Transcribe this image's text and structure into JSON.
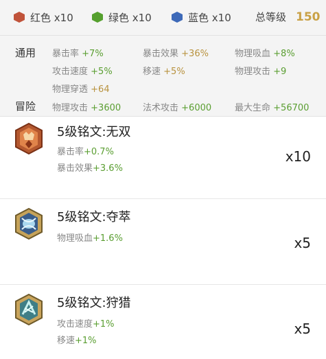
{
  "summary": {
    "gems": [
      {
        "label": "红色 x10",
        "color": "#c0533a"
      },
      {
        "label": "绿色 x10",
        "color": "#55a02e"
      },
      {
        "label": "蓝色 x10",
        "color": "#3d69b8"
      }
    ],
    "total_label": "总等级",
    "total_value": "150",
    "total_color": "#c9a146"
  },
  "stats": {
    "common_label": "通用",
    "adventure_label": "冒险",
    "common": [
      {
        "name": "暴击率",
        "value": "+7%"
      },
      {
        "name": "暴击效果",
        "value": "+36%"
      },
      {
        "name": "物理吸血",
        "value": "+8%"
      },
      {
        "name": "攻击速度",
        "value": "+5%"
      },
      {
        "name": "移速",
        "value": "+5%"
      },
      {
        "name": "物理攻击",
        "value": "+9"
      },
      {
        "name": "物理穿透",
        "value": "+64"
      }
    ],
    "adventure": [
      {
        "name": "物理攻击",
        "value": "+3600"
      },
      {
        "name": "法术攻击",
        "value": "+6000"
      },
      {
        "name": "最大生命",
        "value": "+56700"
      }
    ]
  },
  "inscriptions": [
    {
      "title": "5级铭文:无双",
      "icon": "red-inscription-icon",
      "attrs": [
        {
          "name": "暴击率",
          "value": "+0.7%"
        },
        {
          "name": "暴击效果",
          "value": "+3.6%"
        }
      ],
      "count": "x10"
    },
    {
      "title": "5级铭文:夺萃",
      "icon": "blue-inscription-icon",
      "attrs": [
        {
          "name": "物理吸血",
          "value": "+1.6%"
        }
      ],
      "count": "x5"
    },
    {
      "title": "5级铭文:狩猎",
      "icon": "green-inscription-icon",
      "attrs": [
        {
          "name": "攻击速度",
          "value": "+1%"
        },
        {
          "name": "移速",
          "value": "+1%"
        }
      ],
      "count": "x5"
    }
  ]
}
